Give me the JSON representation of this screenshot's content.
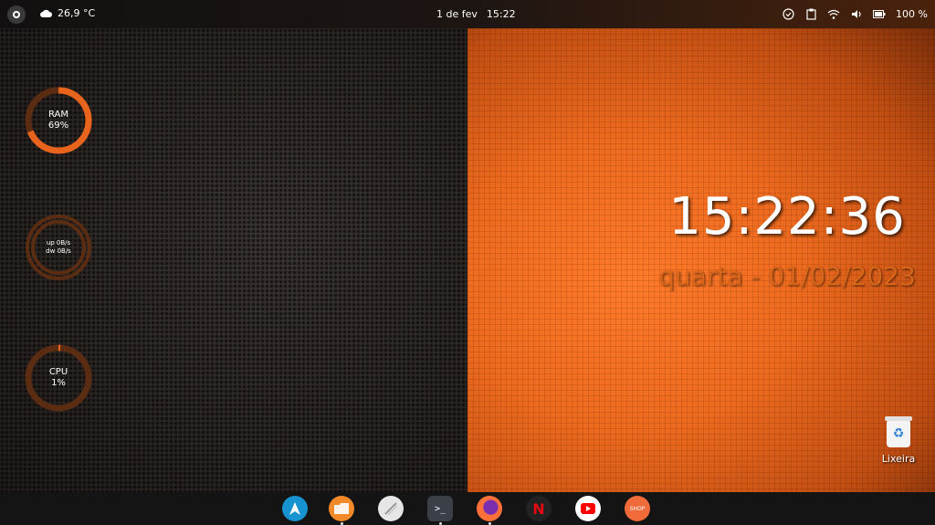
{
  "topbar": {
    "weather_temp": "26,9 °C",
    "date": "1 de fev",
    "time": "15:22",
    "battery": "100 %"
  },
  "widgets": {
    "ram": {
      "label": "RAM",
      "value": "69%",
      "percent": 69
    },
    "net": {
      "up": "up 0B/s",
      "down": "dw 0B/s"
    },
    "cpu": {
      "label": "CPU",
      "value": "1%",
      "percent": 1
    }
  },
  "desktop_clock": {
    "time": "15:22:36",
    "date": "quarta - 01/02/2023"
  },
  "desktop_icons": [
    {
      "label": "Lixeira",
      "icon": "trash-icon"
    }
  ],
  "dock": {
    "items": [
      {
        "icon": "arch-logo-icon",
        "color": "#1793d1",
        "running": false
      },
      {
        "icon": "files-folder-icon",
        "color": "#f28a2a",
        "running": true
      },
      {
        "icon": "text-editor-icon",
        "color": "#e6e6e6",
        "running": false
      },
      {
        "icon": "terminal-icon",
        "color": "#3b3f48",
        "running": true
      },
      {
        "icon": "firefox-icon",
        "color": "#ff7139",
        "running": true
      },
      {
        "icon": "netflix-icon",
        "color": "#222222",
        "running": false
      },
      {
        "icon": "youtube-icon",
        "color": "#ffffff",
        "running": false
      },
      {
        "icon": "shop-icon",
        "color": "#f06a3a",
        "running": false
      }
    ],
    "shop_label": "SHOP"
  },
  "colors": {
    "accent": "#e8641c",
    "gauge_track": "#5a2c12",
    "gauge_fill": "#e8641c"
  }
}
